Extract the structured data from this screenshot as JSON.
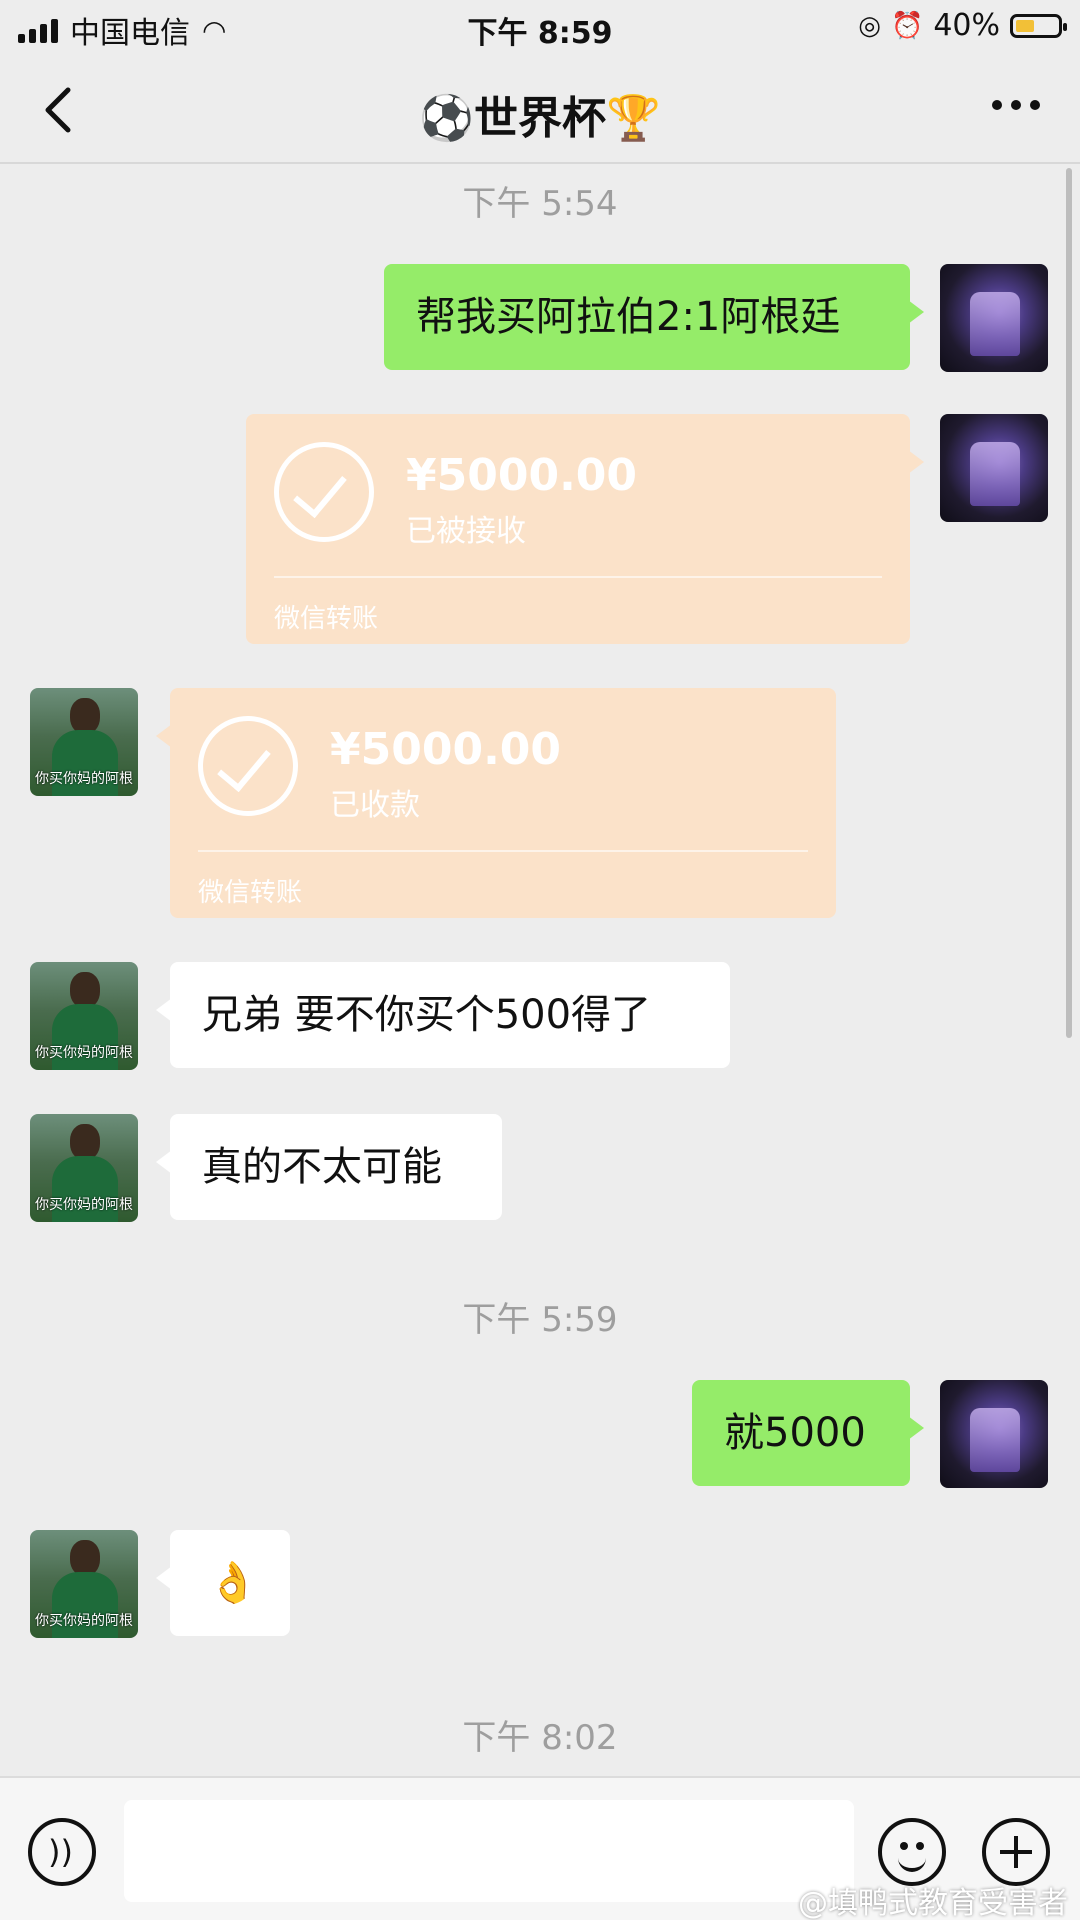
{
  "status_bar": {
    "carrier": "中国电信",
    "time": "下午 8:59",
    "battery": "40%",
    "battery_level": 0.4
  },
  "nav": {
    "title": "⚽世界杯🏆",
    "back_icon": "chevron-left-icon",
    "more_icon": "more-dots-icon"
  },
  "timestamps": [
    "下午 5:54",
    "下午 5:59",
    "下午 8:02"
  ],
  "messages": {
    "m1": "帮我买阿拉伯2:1阿根廷",
    "m5": "兄弟 要不你买个500得了",
    "m6": "真的不太可能",
    "m7": "就5000",
    "m8": "👌"
  },
  "transfers": {
    "t1": {
      "amount": "¥5000.00",
      "status": "已被接收",
      "footer": "微信转账"
    },
    "t2": {
      "amount": "¥5000.00",
      "status": "已收款",
      "footer": "微信转账"
    }
  },
  "avatar_caption": "你买你妈的阿根",
  "input_bar": {
    "voice_icon": "voice-icon",
    "emoji_icon": "emoji-icon",
    "plus_icon": "plus-icon",
    "value": ""
  },
  "watermark": "@填鸭式教育受害者",
  "colors": {
    "background": "#ededed",
    "my_bubble": "#95ec69",
    "friend_bubble": "#ffffff",
    "transfer_card": "#fbe2c9"
  }
}
